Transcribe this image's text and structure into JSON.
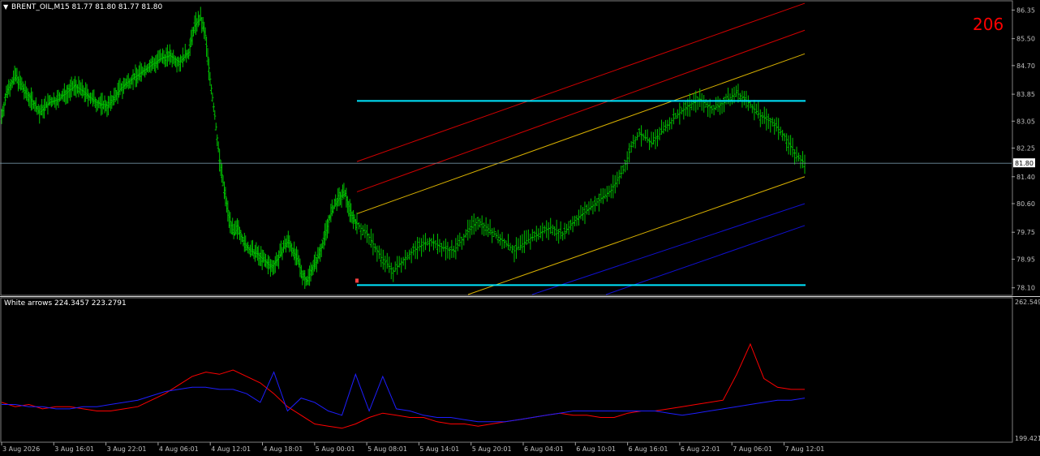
{
  "header": {
    "symbol_line": "BRENT_OIL,M15  81.77 81.80 81.77 81.80",
    "counter": "206"
  },
  "indicator": {
    "label": "White arrows 224.3457 223.2791"
  },
  "colors": {
    "background": "#000000",
    "candles": "#00c000",
    "levels": "#00e5ff",
    "channel_red": "#d00000",
    "channel_orange": "#d8b000",
    "channel_blue": "#1010d0",
    "counter": "#ff0000",
    "series_red": "#ff0000",
    "series_blue": "#1e1eff",
    "axis_text": "#c0c0c0"
  },
  "chart_data": [
    {
      "type": "candlestick",
      "timeframe": "M15",
      "ylim": [
        77.9,
        86.6
      ],
      "yticks": [
        "86.35",
        "85.50",
        "84.70",
        "83.85",
        "83.05",
        "82.25",
        "81.40",
        "80.60",
        "79.75",
        "78.95",
        "78.10"
      ],
      "current_price": "81.80",
      "horizontal_levels": [
        83.65,
        78.18
      ],
      "x_index_range": [
        0,
        300
      ],
      "close_path": [
        [
          0,
          83.2
        ],
        [
          5,
          84.0
        ],
        [
          12,
          84.4
        ],
        [
          20,
          83.9
        ],
        [
          25,
          83.7
        ],
        [
          32,
          83.3
        ],
        [
          40,
          83.6
        ],
        [
          48,
          83.7
        ],
        [
          55,
          83.9
        ],
        [
          62,
          84.1
        ],
        [
          70,
          83.9
        ],
        [
          80,
          83.6
        ],
        [
          90,
          83.5
        ],
        [
          100,
          84.0
        ],
        [
          110,
          84.3
        ],
        [
          118,
          84.5
        ],
        [
          126,
          84.7
        ],
        [
          134,
          84.9
        ],
        [
          142,
          85.0
        ],
        [
          150,
          84.8
        ],
        [
          158,
          85.1
        ],
        [
          163,
          85.9
        ],
        [
          168,
          86.1
        ],
        [
          172,
          85.6
        ],
        [
          176,
          84.3
        ],
        [
          180,
          83.2
        ],
        [
          184,
          81.9
        ],
        [
          188,
          81.0
        ],
        [
          192,
          80.2
        ],
        [
          196,
          79.7
        ],
        [
          200,
          79.9
        ],
        [
          205,
          79.4
        ],
        [
          210,
          79.2
        ],
        [
          216,
          79.1
        ],
        [
          222,
          78.9
        ],
        [
          228,
          78.7
        ],
        [
          234,
          79.0
        ],
        [
          238,
          79.3
        ],
        [
          242,
          79.5
        ],
        [
          246,
          79.2
        ],
        [
          250,
          78.9
        ],
        [
          254,
          78.5
        ],
        [
          258,
          78.3
        ],
        [
          262,
          78.7
        ],
        [
          266,
          78.9
        ],
        [
          270,
          79.3
        ],
        [
          274,
          79.8
        ],
        [
          278,
          80.3
        ],
        [
          282,
          80.6
        ],
        [
          286,
          80.8
        ],
        [
          290,
          80.9
        ],
        [
          294,
          80.4
        ],
        [
          298,
          80.1
        ],
        [
          300,
          80.0
        ]
      ],
      "close_path_2": [
        [
          0,
          80.0
        ],
        [
          6,
          79.6
        ],
        [
          12,
          79.0
        ],
        [
          18,
          78.6
        ],
        [
          24,
          79.0
        ],
        [
          30,
          79.3
        ],
        [
          36,
          79.5
        ],
        [
          42,
          79.3
        ],
        [
          48,
          79.2
        ],
        [
          54,
          79.7
        ],
        [
          60,
          80.1
        ],
        [
          66,
          79.8
        ],
        [
          72,
          79.5
        ],
        [
          78,
          79.2
        ],
        [
          84,
          79.5
        ],
        [
          90,
          79.7
        ],
        [
          96,
          79.9
        ],
        [
          102,
          79.7
        ],
        [
          108,
          80.1
        ],
        [
          114,
          80.4
        ],
        [
          120,
          80.7
        ],
        [
          126,
          81.0
        ],
        [
          132,
          81.6
        ],
        [
          136,
          82.3
        ],
        [
          140,
          82.7
        ],
        [
          146,
          82.4
        ],
        [
          152,
          82.8
        ],
        [
          158,
          83.2
        ],
        [
          164,
          83.5
        ],
        [
          170,
          83.7
        ],
        [
          176,
          83.4
        ],
        [
          182,
          83.6
        ],
        [
          188,
          83.9
        ],
        [
          194,
          83.6
        ],
        [
          200,
          83.2
        ],
        [
          206,
          83.0
        ],
        [
          212,
          82.6
        ],
        [
          218,
          82.0
        ],
        [
          222,
          81.8
        ]
      ],
      "channel_lines": [
        {
          "color": "red",
          "y_start": 81.85,
          "y_end": 86.55
        },
        {
          "color": "red",
          "y_start": 80.95,
          "y_end": 85.75
        },
        {
          "color": "orange",
          "y_start": 80.3,
          "y_end": 85.05
        },
        {
          "color": "orange",
          "y_start": 77.8,
          "y_end": 81.4
        },
        {
          "color": "blue",
          "y_start": 77.8,
          "y_end": 80.6
        },
        {
          "color": "blue",
          "y_start": 77.8,
          "y_end": 79.95
        }
      ]
    },
    {
      "type": "line",
      "name": "White arrows",
      "ylim": [
        199.421,
        262.549
      ],
      "yticks": [
        "262.549",
        "199.421"
      ],
      "series": [
        {
          "key": "red",
          "values": [
            216,
            214,
            215,
            213,
            214,
            214,
            213,
            212,
            212,
            213,
            214,
            217,
            220,
            224,
            228,
            230,
            229,
            231,
            228,
            225,
            220,
            214,
            210,
            206,
            205,
            204,
            206,
            209,
            211,
            210,
            209,
            209,
            207,
            206,
            206,
            205,
            206,
            207,
            208,
            209,
            210,
            211,
            210,
            210,
            209,
            209,
            211,
            212,
            212,
            213,
            214,
            215,
            216,
            217,
            229,
            243,
            227,
            223,
            222,
            222
          ]
        },
        {
          "key": "blue",
          "values": [
            215,
            215,
            214,
            214,
            213,
            213,
            214,
            214,
            215,
            216,
            217,
            219,
            221,
            222,
            223,
            223,
            222,
            222,
            220,
            216,
            230,
            212,
            218,
            216,
            212,
            210,
            229,
            212,
            228,
            213,
            212,
            210,
            209,
            209,
            208,
            207,
            207,
            207,
            208,
            209,
            210,
            211,
            212,
            212,
            212,
            212,
            212,
            212,
            212,
            211,
            210,
            211,
            212,
            213,
            214,
            215,
            216,
            217,
            217,
            218
          ]
        }
      ]
    }
  ],
  "x_axis": {
    "ticks": [
      "3 Aug 2026",
      "3 Aug 16:01",
      "3 Aug 22:01",
      "4 Aug 06:01",
      "4 Aug 12:01",
      "4 Aug 18:01",
      "5 Aug 00:01",
      "5 Aug 08:01",
      "5 Aug 14:01",
      "5 Aug 20:01",
      "6 Aug 04:01",
      "6 Aug 10:01",
      "6 Aug 16:01",
      "6 Aug 22:01",
      "7 Aug 06:01",
      "7 Aug 12:01"
    ]
  }
}
